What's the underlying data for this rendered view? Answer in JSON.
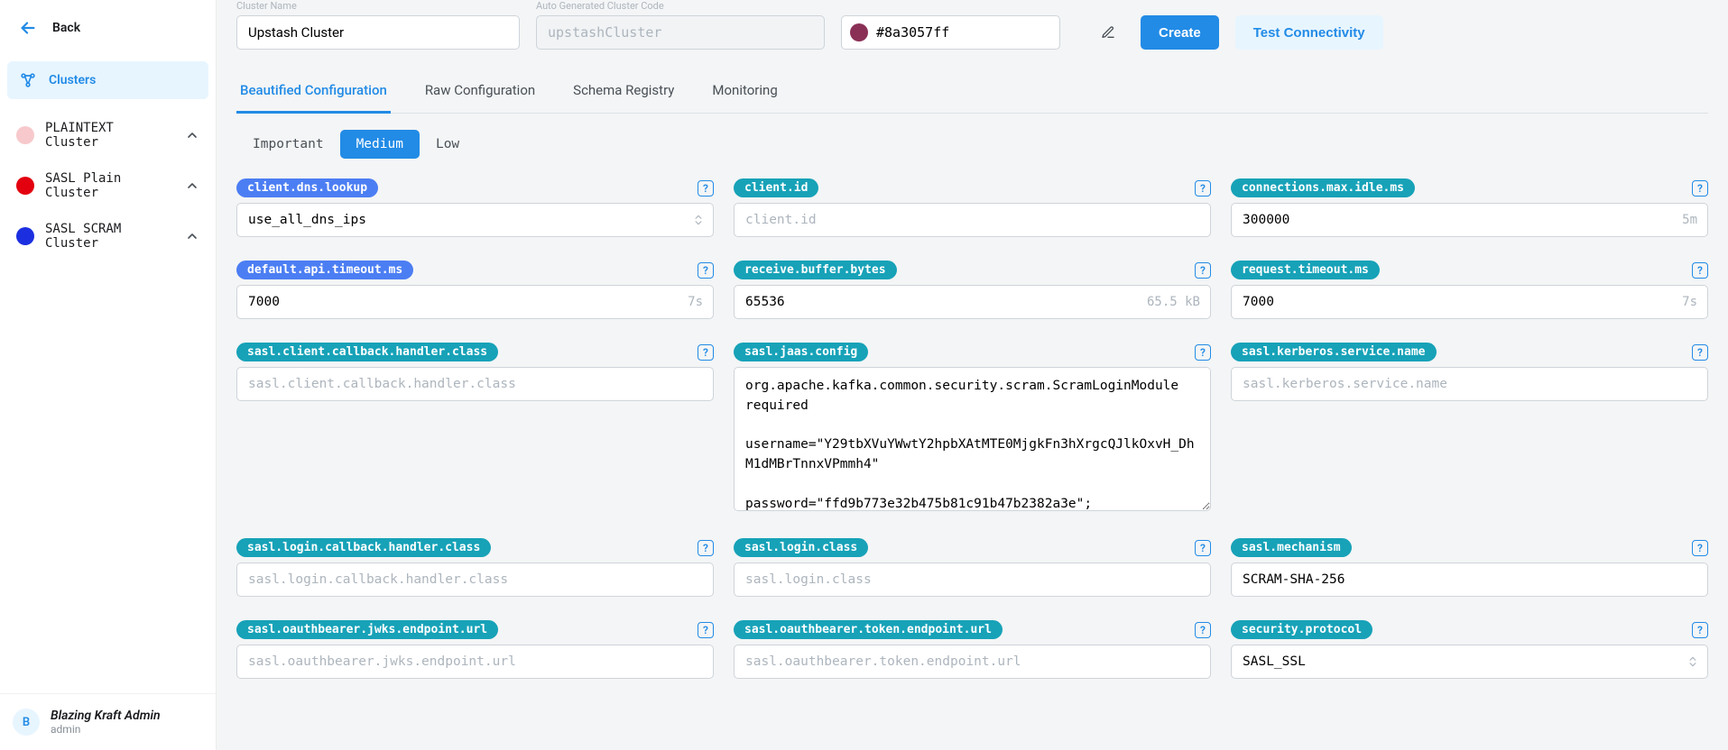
{
  "sidebar": {
    "back_label": "Back",
    "nav": {
      "clusters_label": "Clusters"
    },
    "clusters": [
      {
        "name": "PLAINTEXT Cluster",
        "color": "#f7c9cc"
      },
      {
        "name": "SASL Plain Cluster",
        "color": "#e3000f"
      },
      {
        "name": "SASL SCRAM Cluster",
        "color": "#1c2fe0"
      }
    ],
    "user": {
      "initial": "B",
      "name": "Blazing Kraft Admin",
      "sub": "admin"
    }
  },
  "header": {
    "cluster_name_label": "Cluster Name",
    "cluster_name_value": "Upstash Cluster",
    "cluster_code_label": "Auto Generated Cluster Code",
    "cluster_code_placeholder": "upstashCluster",
    "color_value": "#8a3057ff",
    "color_swatch": "#8a3057",
    "create_label": "Create",
    "test_label": "Test Connectivity"
  },
  "tabs": {
    "items": [
      "Beautified Configuration",
      "Raw Configuration",
      "Schema Registry",
      "Monitoring"
    ],
    "active": 0
  },
  "level_tabs": {
    "items": [
      "Important",
      "Medium",
      "Low"
    ],
    "active": 1
  },
  "configs": [
    {
      "key": "client.dns.lookup",
      "chip": "blue",
      "type": "select",
      "value": "use_all_dns_ips"
    },
    {
      "key": "client.id",
      "chip": "teal",
      "type": "text",
      "value": "",
      "placeholder": "client.id"
    },
    {
      "key": "connections.max.idle.ms",
      "chip": "teal",
      "type": "text",
      "value": "300000",
      "suffix": "5m"
    },
    {
      "key": "default.api.timeout.ms",
      "chip": "blue",
      "type": "text",
      "value": "7000",
      "suffix": "7s"
    },
    {
      "key": "receive.buffer.bytes",
      "chip": "teal",
      "type": "text",
      "value": "65536",
      "suffix": "65.5 kB"
    },
    {
      "key": "request.timeout.ms",
      "chip": "teal",
      "type": "text",
      "value": "7000",
      "suffix": "7s"
    },
    {
      "key": "sasl.client.callback.handler.class",
      "chip": "teal",
      "type": "text",
      "value": "",
      "placeholder": "sasl.client.callback.handler.class"
    },
    {
      "key": "sasl.jaas.config",
      "chip": "teal",
      "type": "textarea",
      "value": "org.apache.kafka.common.security.scram.ScramLoginModule required\n\nusername=\"Y29tbXVuYWwtY2hpbXAtMTE0MjgkFn3hXrgcQJlkOxvH_DhM1dMBrTnnxVPmmh4\"\n\npassword=\"ffd9b773e32b475b81c91b47b2382a3e\";"
    },
    {
      "key": "sasl.kerberos.service.name",
      "chip": "teal",
      "type": "text",
      "value": "",
      "placeholder": "sasl.kerberos.service.name"
    },
    {
      "key": "sasl.login.callback.handler.class",
      "chip": "teal",
      "type": "text",
      "value": "",
      "placeholder": "sasl.login.callback.handler.class"
    },
    {
      "key": "sasl.login.class",
      "chip": "teal",
      "type": "text",
      "value": "",
      "placeholder": "sasl.login.class"
    },
    {
      "key": "sasl.mechanism",
      "chip": "teal",
      "type": "text",
      "value": "SCRAM-SHA-256"
    },
    {
      "key": "sasl.oauthbearer.jwks.endpoint.url",
      "chip": "teal",
      "type": "text",
      "value": "",
      "placeholder": "sasl.oauthbearer.jwks.endpoint.url"
    },
    {
      "key": "sasl.oauthbearer.token.endpoint.url",
      "chip": "teal",
      "type": "text",
      "value": "",
      "placeholder": "sasl.oauthbearer.token.endpoint.url"
    },
    {
      "key": "security.protocol",
      "chip": "teal",
      "type": "select",
      "value": "SASL_SSL"
    }
  ]
}
